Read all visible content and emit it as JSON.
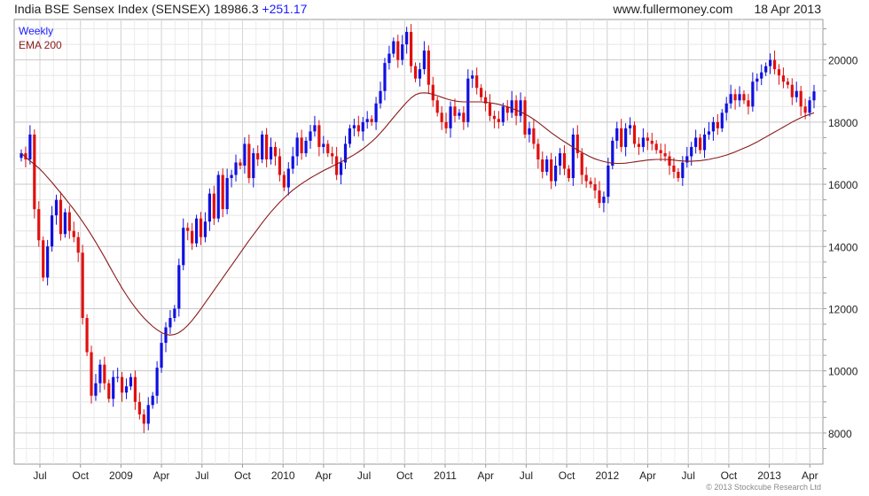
{
  "header": {
    "title": "India BSE Sensex Index (SENSEX)",
    "price": "18986.3",
    "change": "+251.17",
    "website": "www.fullermoney.com",
    "date": "18 Apr 2013"
  },
  "legend": {
    "series1": "Weekly",
    "series2": "EMA 200"
  },
  "copyright": "© 2013 Stockcube Research Ltd",
  "colors": {
    "up": "#1010e0",
    "down": "#e01010",
    "ema": "#8b1a1a",
    "grid": "#d9d9d9"
  },
  "chart_data": {
    "type": "candlestick",
    "y_axis": {
      "min": 7000,
      "max": 21300,
      "ticks": [
        8000,
        10000,
        12000,
        14000,
        16000,
        18000,
        20000
      ],
      "position": "right"
    },
    "x_tick_labels": [
      "Jul",
      "Oct",
      "2009",
      "Apr",
      "Jul",
      "Oct",
      "2010",
      "Apr",
      "Jul",
      "Oct",
      "2011",
      "Apr",
      "Jul",
      "Oct",
      "2012",
      "Apr",
      "Jul",
      "Oct",
      "2013",
      "Apr"
    ],
    "grid": true,
    "weekly_close": [
      17000,
      16800,
      17600,
      15200,
      14200,
      13000,
      14000,
      15000,
      15500,
      14400,
      15100,
      14500,
      14300,
      13800,
      11700,
      10600,
      9200,
      9600,
      10200,
      9600,
      9100,
      9800,
      9800,
      9300,
      9500,
      9800,
      9000,
      8600,
      8300,
      8900,
      9200,
      10100,
      10900,
      11400,
      11700,
      12000,
      13400,
      14600,
      14500,
      14100,
      14900,
      14300,
      14800,
      15700,
      14900,
      16300,
      15200,
      16200,
      16300,
      16700,
      16600,
      17300,
      16200,
      17000,
      16800,
      17600,
      16800,
      17200,
      16900,
      16300,
      15900,
      16500,
      16900,
      17500,
      17000,
      17400,
      17700,
      17900,
      17200,
      17300,
      17000,
      16900,
      16300,
      16700,
      17300,
      17800,
      17900,
      17700,
      18000,
      18100,
      18000,
      18600,
      19000,
      19900,
      20200,
      20600,
      20000,
      20500,
      20900,
      19800,
      19400,
      19700,
      20300,
      19200,
      18700,
      18300,
      18000,
      17800,
      18500,
      18200,
      18300,
      18000,
      19400,
      19500,
      19100,
      18800,
      18600,
      18200,
      18100,
      18000,
      18500,
      18300,
      18700,
      18200,
      18700,
      17600,
      17800,
      17300,
      16800,
      16400,
      16800,
      16100,
      16600,
      17000,
      16500,
      16200,
      17600,
      17000,
      16300,
      16100,
      16000,
      15800,
      15400,
      15600,
      16600,
      17400,
      17800,
      17200,
      17800,
      17900,
      17300,
      17200,
      17500,
      17400,
      17300,
      17100,
      17000,
      16900,
      16600,
      16400,
      16200,
      16700,
      16900,
      17200,
      17500,
      17100,
      17600,
      17700,
      18000,
      17800,
      18300,
      18600,
      18900,
      18700,
      18900,
      18700,
      18500,
      19300,
      19400,
      19600,
      19800,
      20000,
      19700,
      19500,
      19300,
      19200,
      18800,
      19000,
      18500,
      18300,
      18700,
      18986.3
    ],
    "ema_200": [
      17000,
      16870,
      16750,
      16640,
      16520,
      16380,
      16220,
      16060,
      15890,
      15720,
      15550,
      15370,
      15190,
      15000,
      14800,
      14590,
      14370,
      14140,
      13900,
      13660,
      13400,
      13150,
      12900,
      12660,
      12440,
      12230,
      12040,
      11860,
      11700,
      11560,
      11430,
      11320,
      11230,
      11170,
      11150,
      11170,
      11230,
      11330,
      11460,
      11620,
      11800,
      11990,
      12190,
      12390,
      12590,
      12790,
      12990,
      13190,
      13390,
      13590,
      13790,
      13990,
      14190,
      14380,
      14570,
      14760,
      14940,
      15110,
      15270,
      15420,
      15560,
      15690,
      15810,
      15920,
      16020,
      16110,
      16200,
      16280,
      16360,
      16440,
      16510,
      16580,
      16650,
      16720,
      16790,
      16870,
      16950,
      17040,
      17140,
      17250,
      17370,
      17500,
      17650,
      17810,
      17980,
      18150,
      18320,
      18480,
      18640,
      18780,
      18880,
      18930,
      18940,
      18930,
      18890,
      18850,
      18800,
      18750,
      18710,
      18680,
      18660,
      18650,
      18650,
      18650,
      18650,
      18650,
      18640,
      18620,
      18600,
      18570,
      18530,
      18490,
      18440,
      18390,
      18330,
      18260,
      18180,
      18090,
      17990,
      17880,
      17770,
      17660,
      17560,
      17460,
      17370,
      17280,
      17190,
      17100,
      17020,
      16950,
      16880,
      16820,
      16770,
      16730,
      16700,
      16680,
      16670,
      16670,
      16680,
      16700,
      16720,
      16740,
      16760,
      16780,
      16790,
      16800,
      16800,
      16800,
      16790,
      16780,
      16760,
      16750,
      16740,
      16740,
      16750,
      16760,
      16780,
      16800,
      16830,
      16860,
      16900,
      16940,
      16990,
      17040,
      17100,
      17160,
      17220,
      17290,
      17360,
      17440,
      17520,
      17600,
      17680,
      17760,
      17840,
      17920,
      18000,
      18070,
      18140,
      18200,
      18250,
      18300
    ]
  }
}
